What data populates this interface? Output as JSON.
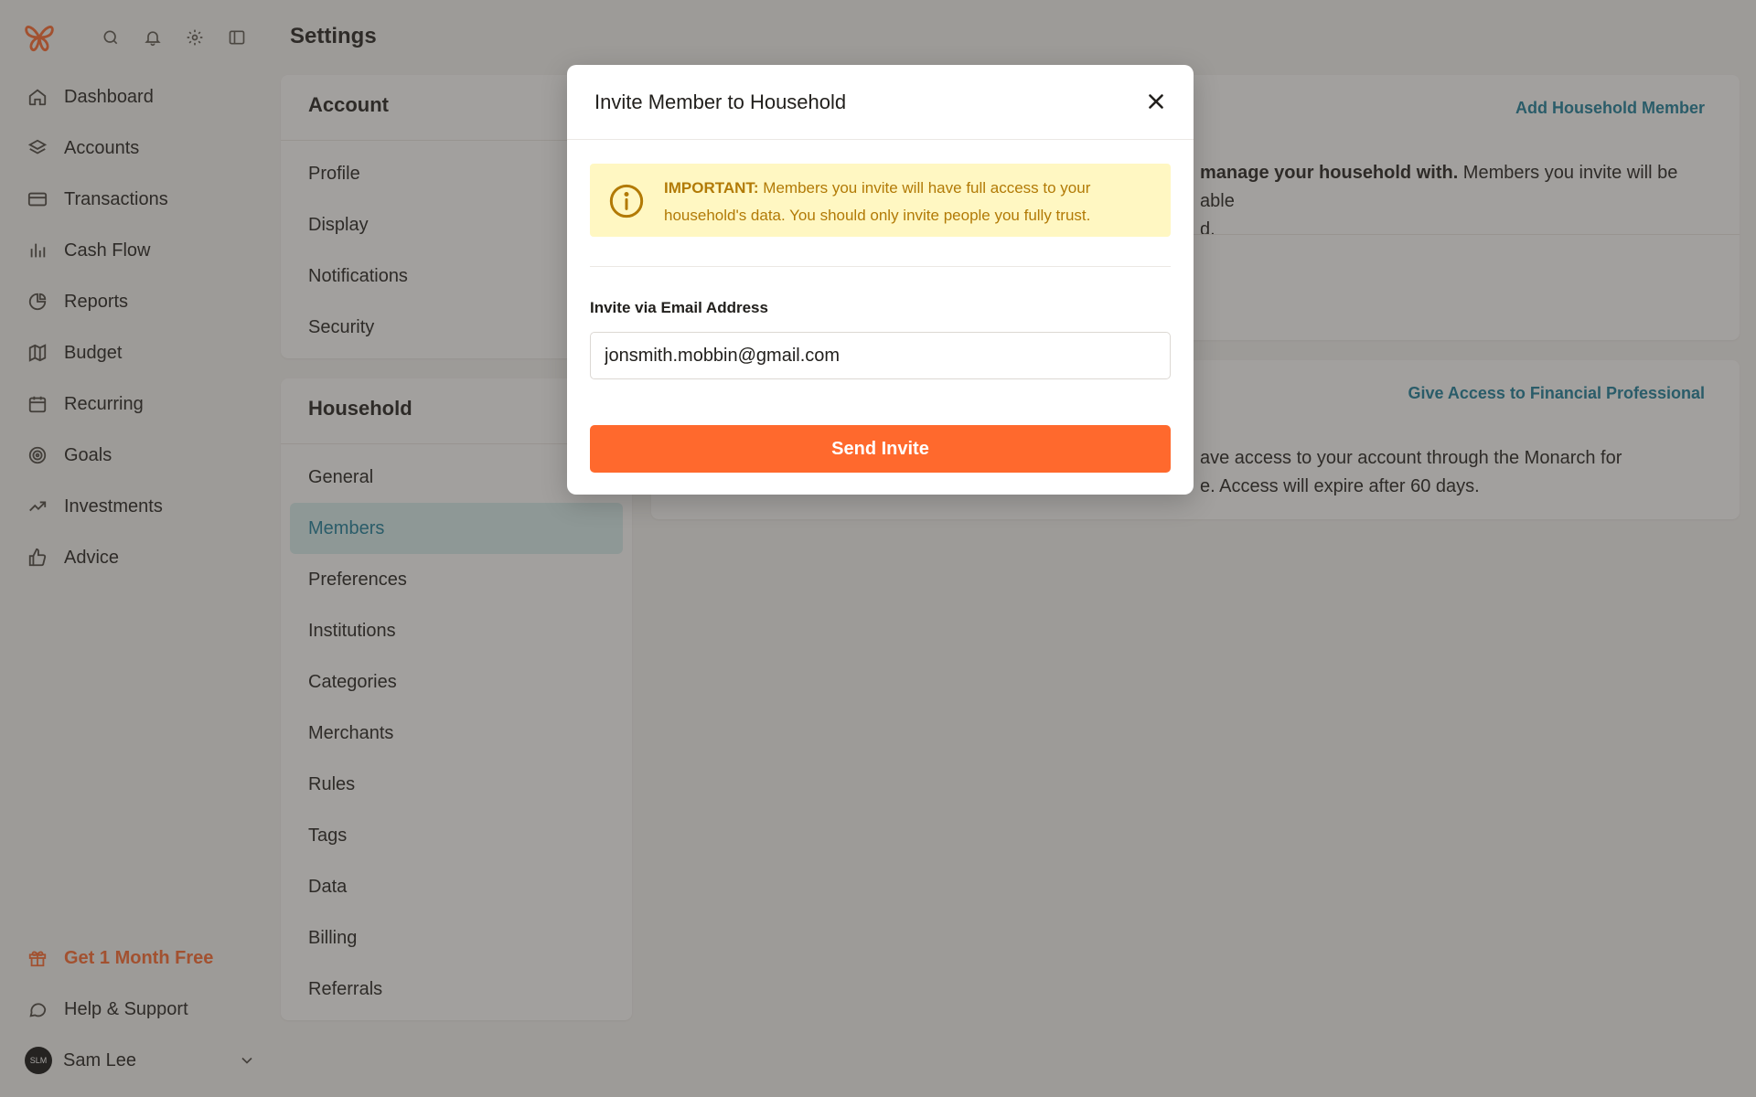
{
  "header": {
    "title": "Settings"
  },
  "topbar": {
    "icons": [
      "butterfly-logo",
      "search-icon",
      "bell-icon",
      "gear-icon",
      "sidebar-toggle-icon"
    ]
  },
  "sidebar": {
    "items": [
      {
        "label": "Dashboard",
        "icon": "home-icon"
      },
      {
        "label": "Accounts",
        "icon": "layers-icon"
      },
      {
        "label": "Transactions",
        "icon": "credit-card-icon"
      },
      {
        "label": "Cash Flow",
        "icon": "bar-chart-icon"
      },
      {
        "label": "Reports",
        "icon": "pie-chart-icon"
      },
      {
        "label": "Budget",
        "icon": "map-icon"
      },
      {
        "label": "Recurring",
        "icon": "calendar-icon"
      },
      {
        "label": "Goals",
        "icon": "target-icon"
      },
      {
        "label": "Investments",
        "icon": "trending-up-icon"
      },
      {
        "label": "Advice",
        "icon": "thumbs-up-icon"
      }
    ],
    "promo": "Get 1 Month Free",
    "help": "Help & Support",
    "user": {
      "name": "Sam Lee",
      "initials": "SLM"
    }
  },
  "account_section": {
    "title": "Account",
    "items": [
      "Profile",
      "Display",
      "Notifications",
      "Security"
    ]
  },
  "household_section": {
    "title": "Household",
    "items": [
      "General",
      "Members",
      "Preferences",
      "Institutions",
      "Categories",
      "Merchants",
      "Rules",
      "Tags",
      "Data",
      "Billing",
      "Referrals"
    ],
    "active": "Members"
  },
  "members_panel": {
    "action": "Add Household Member",
    "text_bold": "manage your household with.",
    "text_line1": " Members you invite will be able",
    "text_line2": "d."
  },
  "pro_panel": {
    "action": "Give Access to Financial Professional",
    "text_line1": "ave access to your account through the Monarch for",
    "text_line2": "e. Access will expire after 60 days."
  },
  "modal": {
    "title": "Invite Member to Household",
    "alert_strong": "IMPORTANT:",
    "alert_text": " Members you invite will have full access to your household's data. You should only invite people you fully trust.",
    "field_label": "Invite via Email Address",
    "email_value": "jonsmith.mobbin@gmail.com",
    "submit_label": "Send Invite"
  },
  "colors": {
    "accent": "#ff692d",
    "link": "#1a7e9a",
    "alert_bg": "#fff7c2",
    "alert_text": "#b27a06",
    "active_bg": "#d8efef"
  }
}
